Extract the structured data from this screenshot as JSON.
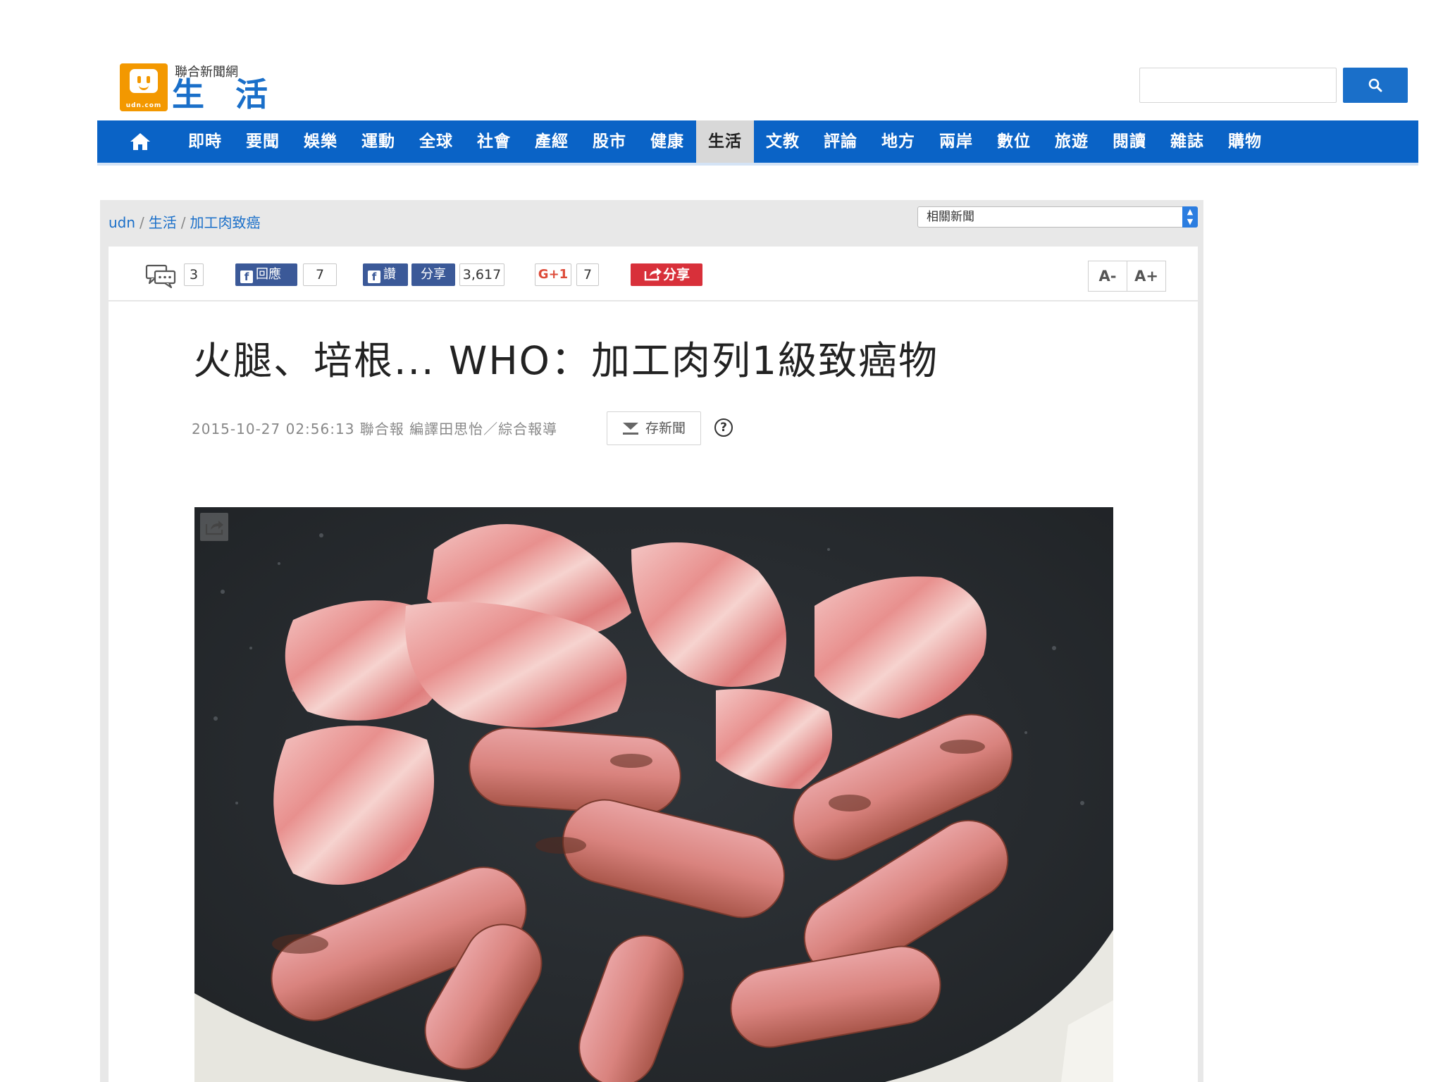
{
  "header": {
    "logo_small": "聯合新聞網",
    "logo_big": "生 活",
    "logo_udn": "udn.com",
    "search": {
      "value": "",
      "placeholder": ""
    }
  },
  "nav": {
    "home_icon": "home-icon",
    "items": [
      "即時",
      "要聞",
      "娛樂",
      "運動",
      "全球",
      "社會",
      "產經",
      "股市",
      "健康",
      "生活",
      "文教",
      "評論",
      "地方",
      "兩岸",
      "數位",
      "旅遊",
      "閱讀",
      "雜誌",
      "購物"
    ],
    "active": "生活"
  },
  "breadcrumb": [
    "udn",
    "生活",
    "加工肉致癌"
  ],
  "related_select": "相關新聞",
  "share_bar": {
    "comment_count": "3",
    "fb_reply_label": "回應",
    "fb_reply_count": "7",
    "fb_like_label": "讚",
    "fb_share_label": "分享",
    "fb_share_count": "3,617",
    "gplus_label": "G+1",
    "gplus_count": "7",
    "share_label": "分享",
    "font_smaller": "A-",
    "font_larger": "A+"
  },
  "article": {
    "title": "火腿、培根... WHO：加工肉列1級致癌物",
    "meta": "2015-10-27 02:56:13 聯合報 編譯田思怡／綜合報導",
    "save_label": "存新聞",
    "help": "?"
  },
  "colors": {
    "nav_bg": "#0a63c6",
    "brand_blue": "#1a6fc9",
    "logo_orange": "#f39800",
    "facebook": "#3b5998",
    "share_red": "#d8303a",
    "gplus_red": "#dd4b39"
  }
}
